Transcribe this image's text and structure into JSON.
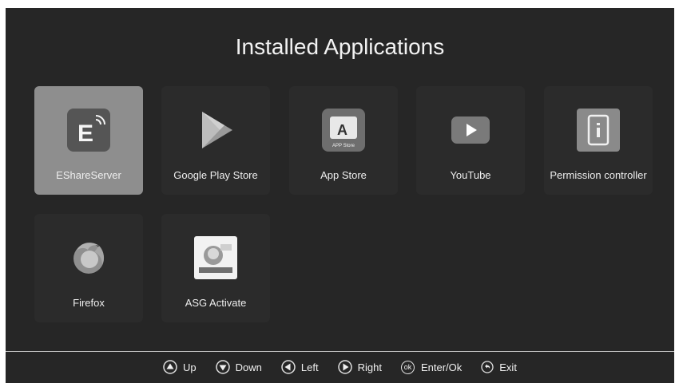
{
  "header": {
    "title": "Installed Applications"
  },
  "apps": [
    {
      "label": "EShareServer",
      "icon": "eshare-icon",
      "selected": true
    },
    {
      "label": "Google Play Store",
      "icon": "google-play-icon",
      "selected": false
    },
    {
      "label": "App Store",
      "icon": "app-store-icon",
      "icon_text": "APP Store",
      "selected": false
    },
    {
      "label": "YouTube",
      "icon": "youtube-icon",
      "selected": false
    },
    {
      "label": "Permission controller",
      "icon": "permission-icon",
      "selected": false
    },
    {
      "label": "Firefox",
      "icon": "firefox-icon",
      "selected": false
    },
    {
      "label": "ASG Activate",
      "icon": "asg-activate-icon",
      "selected": false
    }
  ],
  "footer": {
    "hints": [
      {
        "icon": "up-icon",
        "label": "Up"
      },
      {
        "icon": "down-icon",
        "label": "Down"
      },
      {
        "icon": "left-icon",
        "label": "Left"
      },
      {
        "icon": "right-icon",
        "label": "Right"
      },
      {
        "icon": "ok-icon",
        "icon_text": "ok",
        "label": "Enter/Ok"
      },
      {
        "icon": "exit-icon",
        "label": "Exit"
      }
    ]
  },
  "colors": {
    "background": "#262626",
    "tile": "#2b2b2b",
    "tile_selected": "#8e8e8e",
    "text": "#f2f2f2"
  }
}
